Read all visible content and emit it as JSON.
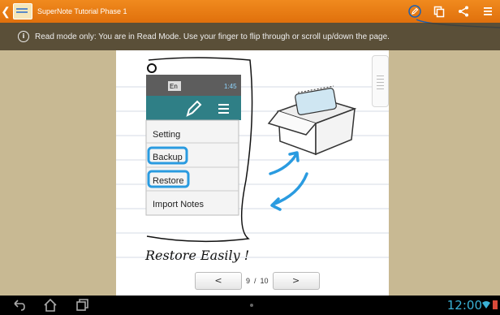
{
  "app": {
    "title": "SuperNote Tutorial Phase 1"
  },
  "notice": {
    "text": "Read mode only: You are in Read Mode. Use your finger to flip through or scroll up/down the page."
  },
  "illustration": {
    "status_time": "1:45",
    "lang": "En",
    "menu_items": [
      "Setting",
      "Backup",
      "Restore",
      "Import Notes"
    ],
    "caption": "Restore Easily !"
  },
  "pager": {
    "prev": "<",
    "next": ">",
    "current": "9",
    "separator": "/",
    "total": "10"
  },
  "system": {
    "clock": "12:00"
  },
  "colors": {
    "accent": "#f08a1e",
    "highlight": "#2a9be0",
    "clock": "#3ab2d6"
  }
}
